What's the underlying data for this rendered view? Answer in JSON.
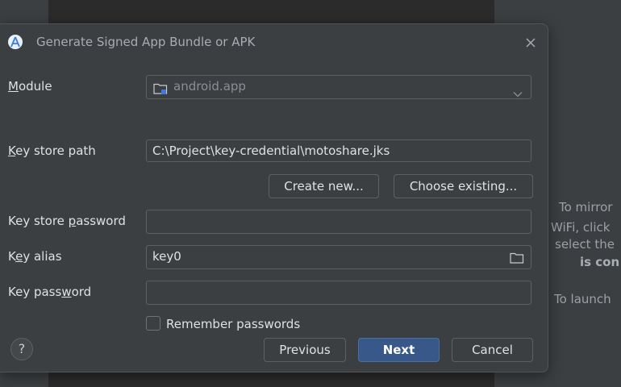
{
  "dialog": {
    "title": "Generate Signed App Bundle or APK",
    "module_label_first": "M",
    "module_label_rest": "odule",
    "module_value": "android.app",
    "keystore_path_label_first": "K",
    "keystore_path_label_rest": "ey store path",
    "keystore_path_value": "C:\\Project\\key-credential\\motoshare.jks",
    "create_new_label": "Create new...",
    "choose_existing_label": "Choose existing...",
    "keystore_password_label_pre": "Key store ",
    "keystore_password_label_u": "p",
    "keystore_password_label_post": "assword",
    "keystore_password_value": "",
    "key_alias_label_pre": "K",
    "key_alias_label_u": "e",
    "key_alias_label_post": "y alias",
    "key_alias_value": "key0",
    "key_password_label_pre": "Key pass",
    "key_password_label_u": "w",
    "key_password_label_post": "ord",
    "key_password_value": "",
    "remember_label": "Remember passwords",
    "remember_checked": false,
    "help_label": "?",
    "previous_label": "Previous",
    "next_label": "Next",
    "cancel_label": "Cancel"
  },
  "background_panel": {
    "line1": "To mirror",
    "line2": "WiFi, click",
    "line3": "select the",
    "line4": "is con",
    "line5": "To launch"
  },
  "colors": {
    "dialog_bg": "#3c3f41",
    "primary_button": "#375888",
    "text": "#dfe1e5"
  }
}
